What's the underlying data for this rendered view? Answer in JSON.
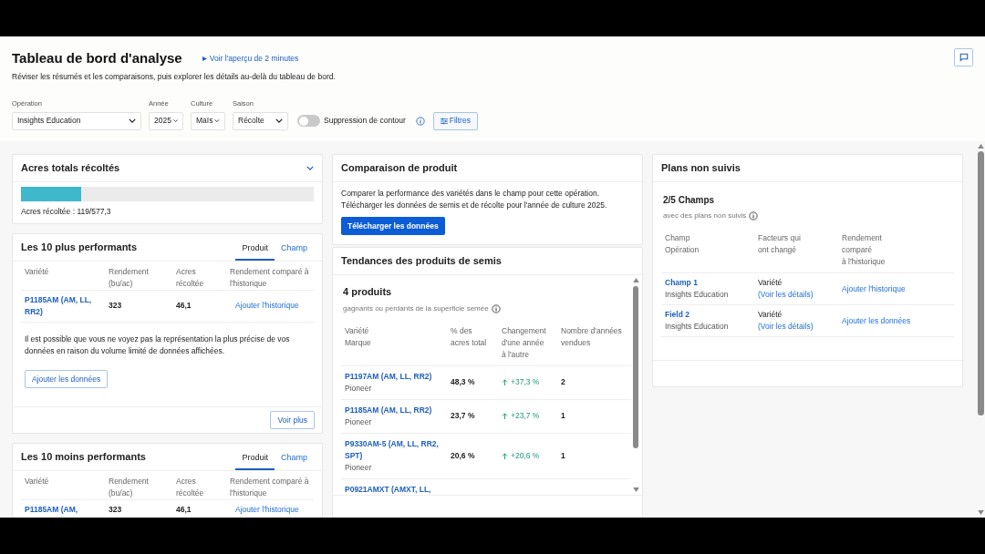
{
  "header": {
    "title": "Tableau de bord d'analyse",
    "tour_link": "Voir l'aperçu de 2 minutes",
    "subtitle": "Réviser les résumés et les comparaisons, puis explorer les détails au-delà du tableau de bord."
  },
  "filters": {
    "selects": [
      {
        "label": "Opération",
        "value": "Insights Education"
      },
      {
        "label": "Année",
        "value": "2025"
      },
      {
        "label": "Culture",
        "value": "Maïs"
      },
      {
        "label": "Saison",
        "value": "Récolte"
      }
    ],
    "toggle": {
      "label": "Suppression de contour",
      "on": false
    },
    "filters_button": "Filtres"
  },
  "acres": {
    "title": "Acres totals récoltés",
    "level": 0.206,
    "reading": "Acres récoltée : 119/577,3"
  },
  "top10": {
    "title": "Les 10 plus performants",
    "tabs": [
      {
        "label": "Produit",
        "selected": true
      },
      {
        "label": "Champ",
        "selected": false
      }
    ],
    "columns": [
      [
        "Variété"
      ],
      [
        "Rendement",
        "(bu/ac)"
      ],
      [
        "Acres",
        "récoltée"
      ],
      [
        "Rendement comparé à",
        "l'historique"
      ]
    ],
    "rows": [
      {
        "variety": "P1185AM (AM, LL, RR2)",
        "yield": "323",
        "acres": "46,1",
        "history": "Ajouter l'historique"
      }
    ],
    "note": "Il est possible que vous ne voyez pas la représentation la plus précise de vos données en raison du volume limité de données affichées.",
    "add_button": "Ajouter les données",
    "more_button": "Voir plus"
  },
  "bottom10": {
    "title": "Les 10 moins performants",
    "tabs": [
      {
        "label": "Produit",
        "selected": true
      },
      {
        "label": "Champ",
        "selected": false
      }
    ],
    "columns": [
      [
        "Variété"
      ],
      [
        "Rendement",
        "(bu/ac)"
      ],
      [
        "Acres",
        "récoltée"
      ],
      [
        "Rendement comparé à",
        "l'historique"
      ]
    ],
    "rows": [
      {
        "variety": "P1185AM (AM,",
        "yield": "323",
        "acres": "46,1",
        "history": "Ajouter l'historique"
      }
    ]
  },
  "comparison": {
    "title": "Comparaison de produit",
    "lines": [
      "Comparer la performance des variétés dans le champ pour cette opération.",
      "Télécharger les données de semis et de récolte pour l'année de culture 2025."
    ],
    "button": "Télécharger les données"
  },
  "trends": {
    "title": "Tendances des produits de semis",
    "count": "4 produits",
    "subtitle": "gagnants ou perdants de la superficie semée",
    "columns": [
      [
        "Variété",
        "Marque"
      ],
      [
        "% des",
        "acres total"
      ],
      [
        "Changement",
        "d'une année",
        "à l'autre"
      ],
      [
        "Nombre d'années",
        "vendues"
      ]
    ],
    "rows": [
      {
        "variety": "P1197AM (AM, LL, RR2)",
        "brand": "Pioneer",
        "share": "48,3 %",
        "change": "+37,3 %",
        "years": "2"
      },
      {
        "variety": "P1185AM (AM, LL, RR2)",
        "brand": "Pioneer",
        "share": "23,7 %",
        "change": "+23,7 %",
        "years": "1"
      },
      {
        "variety": "P9330AM-5 (AM, LL, RR2, SPT)",
        "brand": "Pioneer",
        "share": "20,6 %",
        "change": "+20,6 %",
        "years": "1"
      },
      {
        "variety": "P0921AMXT (AMXT, LL,"
      }
    ]
  },
  "plans": {
    "title": "Plans non suivis",
    "count": "2/5 Champs",
    "subtitle": "avec des plans non suivis",
    "columns": [
      [
        "Champ",
        "Opération"
      ],
      [
        "Facteurs qui",
        "ont changé"
      ],
      [
        "Rendement",
        "comparé",
        "à l'historique"
      ]
    ],
    "rows": [
      {
        "field": "Champ 1",
        "operation": "Insights Education",
        "factor": "Variété",
        "details": "(Voir les détails)",
        "action": "Ajouter l'historique"
      },
      {
        "field": "Field 2",
        "operation": "Insights Education",
        "factor": "Variété",
        "details": "(Voir les détails)",
        "action": "Ajouter les données"
      }
    ]
  }
}
